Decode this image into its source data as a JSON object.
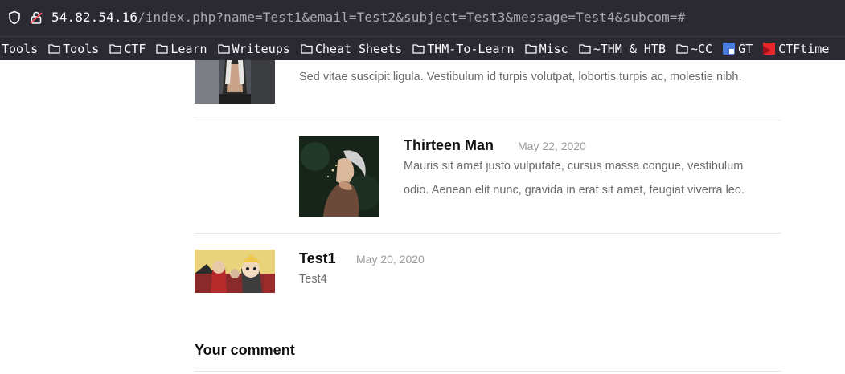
{
  "browser": {
    "url_host": "54.82.54.16",
    "url_path": "/index.php?name=Test1&email=Test2&subject=Test3&message=Test4&subcom=#",
    "bookmarks": [
      {
        "label": "Tools",
        "icon": "none"
      },
      {
        "label": "Tools",
        "icon": "folder-icon"
      },
      {
        "label": "CTF",
        "icon": "folder-icon"
      },
      {
        "label": "Learn",
        "icon": "folder-icon"
      },
      {
        "label": "Writeups",
        "icon": "folder-icon"
      },
      {
        "label": "Cheat Sheets",
        "icon": "folder-icon"
      },
      {
        "label": "THM-To-Learn",
        "icon": "folder-icon"
      },
      {
        "label": "Misc",
        "icon": "folder-icon"
      },
      {
        "label": "~THM & HTB",
        "icon": "folder-icon"
      },
      {
        "label": "~CC",
        "icon": "folder-icon"
      },
      {
        "label": "GT",
        "icon": "translate-icon"
      },
      {
        "label": "CTFtime",
        "icon": "ctftime-icon"
      }
    ]
  },
  "comments": [
    {
      "name": "",
      "date": "",
      "text": "Sed vitae suscipit ligula. Vestibulum id turpis volutpat, lobortis turpis ac, molestie nibh."
    },
    {
      "name": "Thirteen Man",
      "date": "May 22, 2020",
      "text": "Mauris sit amet justo vulputate, cursus massa congue, vestibulum odio. Aenean elit nunc, gravida in erat sit amet, feugiat viverra leo."
    },
    {
      "name": "Test1",
      "date": "May 20, 2020",
      "text": "Test4"
    }
  ],
  "form": {
    "heading": "Your comment"
  },
  "colors": {
    "chrome_bg": "#2b2a33",
    "heading": "#111111",
    "meta": "#9a9a9a",
    "body_text": "#6b6b6b"
  }
}
